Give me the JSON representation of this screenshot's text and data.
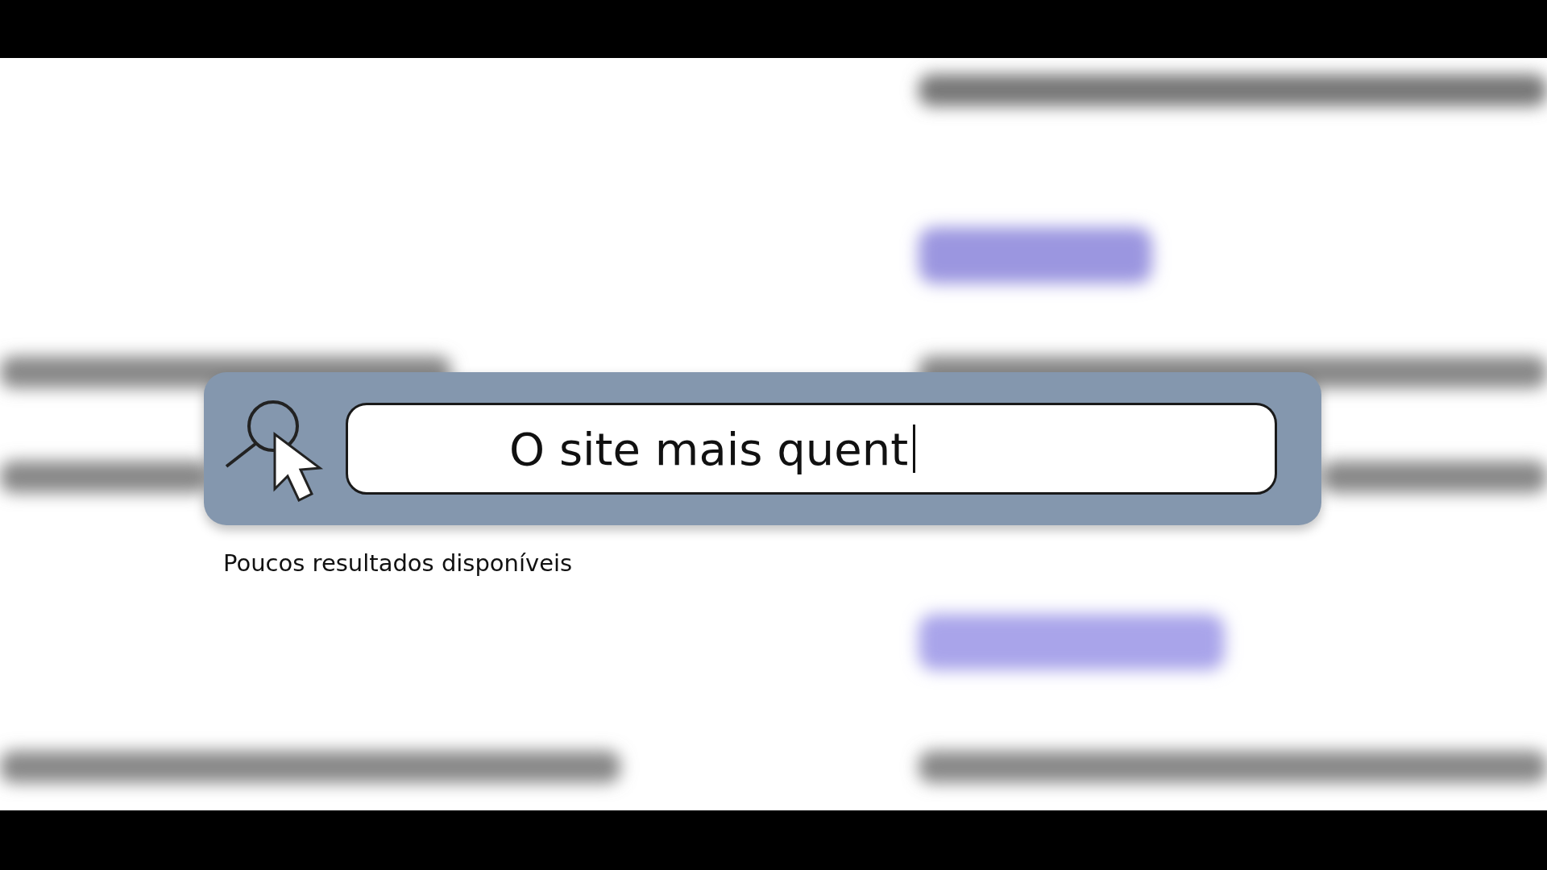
{
  "search": {
    "value": "O site mais quent",
    "hint": "Poucos resultados disponíveis"
  }
}
